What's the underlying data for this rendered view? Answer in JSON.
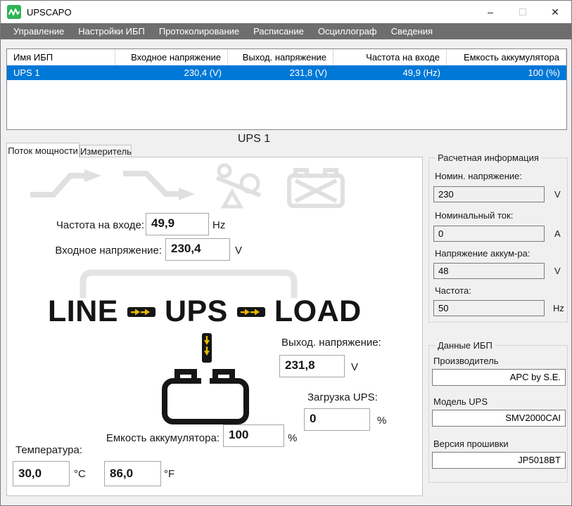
{
  "window": {
    "title": "UPSCAPO",
    "controls": {
      "minimize": "–",
      "close": "✕"
    }
  },
  "menu": {
    "items": [
      "Управление",
      "Настройки ИБП",
      "Протоколирование",
      "Расписание",
      "Осциллограф",
      "Сведения"
    ]
  },
  "table": {
    "columns": [
      "Имя ИБП",
      "Входное напряжение",
      "Выход. напряжение",
      "Частота на входе",
      "Емкость аккумулятора"
    ],
    "rows": [
      [
        "UPS 1",
        "230,4 (V)",
        "231,8 (V)",
        "49,9 (Hz)",
        "100 (%)"
      ]
    ]
  },
  "selected_ups": "UPS 1",
  "tabs": [
    {
      "label": "Поток мощности"
    },
    {
      "label": "Измеритель"
    }
  ],
  "flow": {
    "freq_label": "Частота на входе:",
    "freq_value": "49,9",
    "freq_unit": "Hz",
    "input_v_label": "Входное напряжение:",
    "input_v_value": "230,4",
    "input_v_unit": "V",
    "line": "LINE",
    "ups": "UPS",
    "load": "LOAD",
    "output_v_label": "Выход. напряжение:",
    "output_v_value": "231,8",
    "output_v_unit": "V",
    "load_label": "Загрузка UPS:",
    "load_value": "0",
    "load_unit": "%",
    "capacity_label": "Емкость аккумулятора:",
    "capacity_value": "100",
    "capacity_unit": "%",
    "temp_label": "Температура:",
    "temp_c_value": "30,0",
    "temp_c_unit": "°C",
    "temp_f_value": "86,0",
    "temp_f_unit": "°F"
  },
  "calc_info": {
    "title": "Расчетная информация",
    "fields": [
      {
        "label": "Номин. напряжение:",
        "value": "230",
        "unit": "V"
      },
      {
        "label": "Номинальный ток:",
        "value": "0",
        "unit": "A"
      },
      {
        "label": "Напряжение аккум-ра:",
        "value": "48",
        "unit": "V"
      },
      {
        "label": "Частота:",
        "value": "50",
        "unit": "Hz"
      }
    ]
  },
  "ups_data": {
    "title": "Данные ИБП",
    "fields": [
      {
        "label": "Производитель",
        "value": "APC by S.E."
      },
      {
        "label": "Модель UPS",
        "value": "SMV2000CAI"
      },
      {
        "label": "Версия прошивки",
        "value": "JP5018BT"
      }
    ]
  },
  "colors": {
    "selection_blue": "#0078d7",
    "menu_gray": "#6e6e6e",
    "brand_green": "#2fb457",
    "arrow_yellow": "#e8b800"
  }
}
